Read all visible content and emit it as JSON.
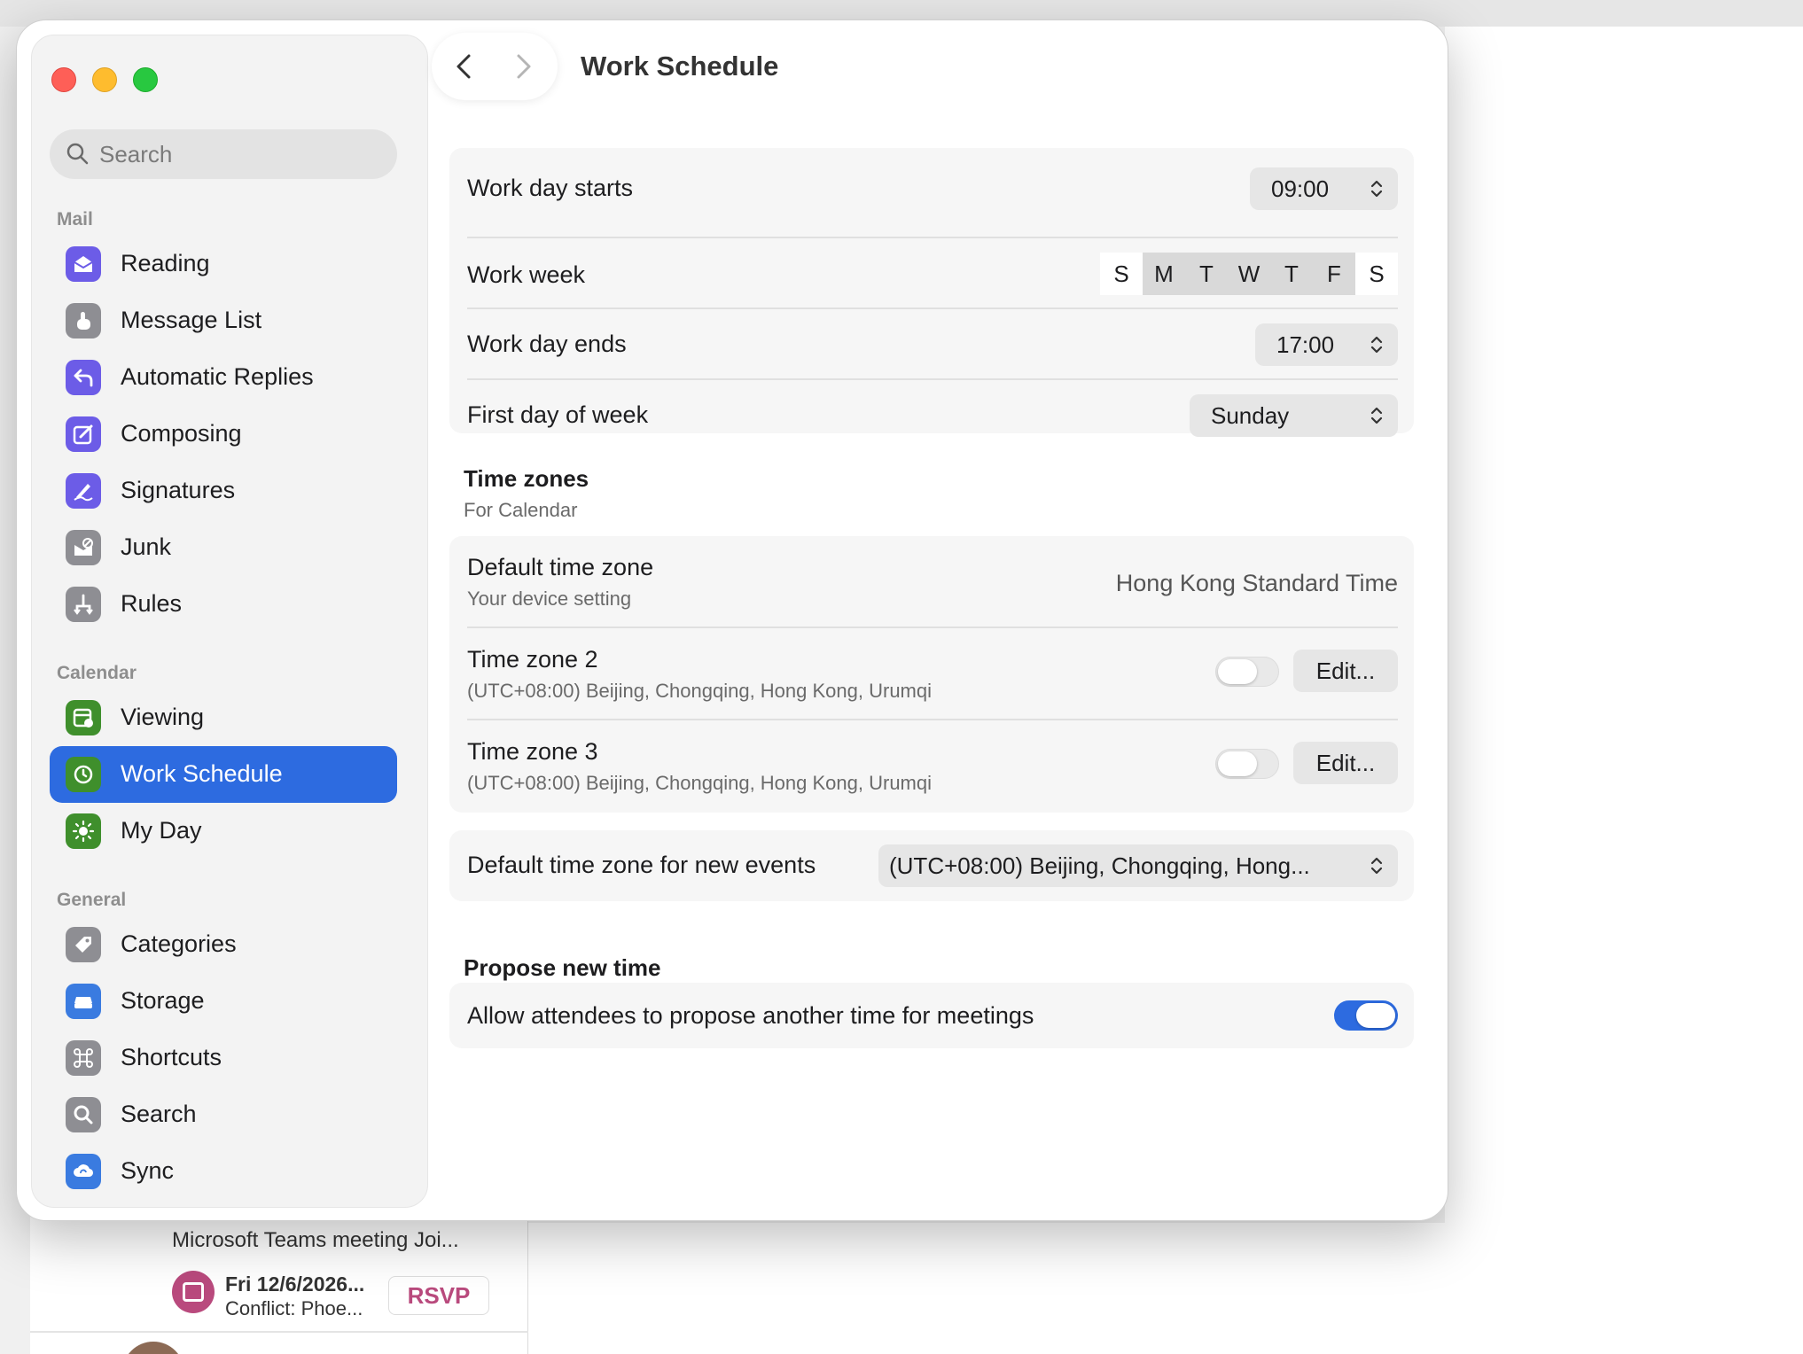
{
  "background": {
    "email_subject": "Microsoft Teams meeting Joi...",
    "event_date": "Fri 12/6/2026...",
    "event_conflict": "Conflict: Phoe...",
    "rsvp_label": "RSVP"
  },
  "sidebar": {
    "search_placeholder": "Search",
    "sections": [
      {
        "label": "Mail"
      },
      {
        "label": "Calendar"
      },
      {
        "label": "General"
      }
    ],
    "items": [
      {
        "label": "Reading",
        "icon": "envelope-open-icon",
        "color": "#6c5ce7"
      },
      {
        "label": "Message List",
        "icon": "hand-pointer-icon",
        "color": "#8e8e93"
      },
      {
        "label": "Automatic Replies",
        "icon": "reply-arrow-icon",
        "color": "#6c5ce7"
      },
      {
        "label": "Composing",
        "icon": "compose-icon",
        "color": "#6c5ce7"
      },
      {
        "label": "Signatures",
        "icon": "signature-pen-icon",
        "color": "#6c5ce7"
      },
      {
        "label": "Junk",
        "icon": "junk-icon",
        "color": "#8e8e93"
      },
      {
        "label": "Rules",
        "icon": "rules-icon",
        "color": "#8e8e93"
      },
      {
        "label": "Viewing",
        "icon": "calendar-gear-icon",
        "color": "#3f8f2c"
      },
      {
        "label": "Work Schedule",
        "icon": "clock-icon",
        "color": "#3f8f2c",
        "active": true
      },
      {
        "label": "My Day",
        "icon": "sun-icon",
        "color": "#3f8f2c"
      },
      {
        "label": "Categories",
        "icon": "tag-icon",
        "color": "#8e8e93"
      },
      {
        "label": "Storage",
        "icon": "storage-drive-icon",
        "color": "#3a7be0"
      },
      {
        "label": "Shortcuts",
        "icon": "command-key-icon",
        "color": "#8e8e93"
      },
      {
        "label": "Search",
        "icon": "search-icon",
        "color": "#8e8e93"
      },
      {
        "label": "Sync",
        "icon": "sync-cloud-icon",
        "color": "#3a7be0"
      }
    ]
  },
  "header": {
    "title": "Work Schedule"
  },
  "work_hours": {
    "day_starts_label": "Work day starts",
    "day_starts_value": "09:00",
    "week_label": "Work week",
    "week_days": [
      "S",
      "M",
      "T",
      "W",
      "T",
      "F",
      "S"
    ],
    "week_days_selected": [
      false,
      true,
      true,
      true,
      true,
      true,
      false
    ],
    "day_ends_label": "Work day ends",
    "day_ends_value": "17:00",
    "first_day_label": "First day of week",
    "first_day_value": "Sunday"
  },
  "time_zones": {
    "heading": "Time zones",
    "subheading": "For Calendar",
    "default_label": "Default time zone",
    "default_sub": "Your device setting",
    "default_value": "Hong Kong Standard Time",
    "tz2_label": "Time zone 2",
    "tz2_sub": "(UTC+08:00) Beijing, Chongqing, Hong Kong, Urumqi",
    "tz2_enabled": false,
    "tz2_edit": "Edit...",
    "tz3_label": "Time zone 3",
    "tz3_sub": "(UTC+08:00) Beijing, Chongqing, Hong Kong, Urumqi",
    "tz3_enabled": false,
    "tz3_edit": "Edit...",
    "new_events_label": "Default time zone for new events",
    "new_events_value": "(UTC+08:00) Beijing, Chongqing, Hong..."
  },
  "propose": {
    "heading": "Propose new time",
    "allow_label": "Allow attendees to propose another time for meetings",
    "allow_enabled": true
  },
  "colors": {
    "accent": "#2d6be0",
    "traffic_red": "#fe5f57",
    "traffic_yellow": "#febc2e",
    "traffic_green": "#28c840"
  }
}
